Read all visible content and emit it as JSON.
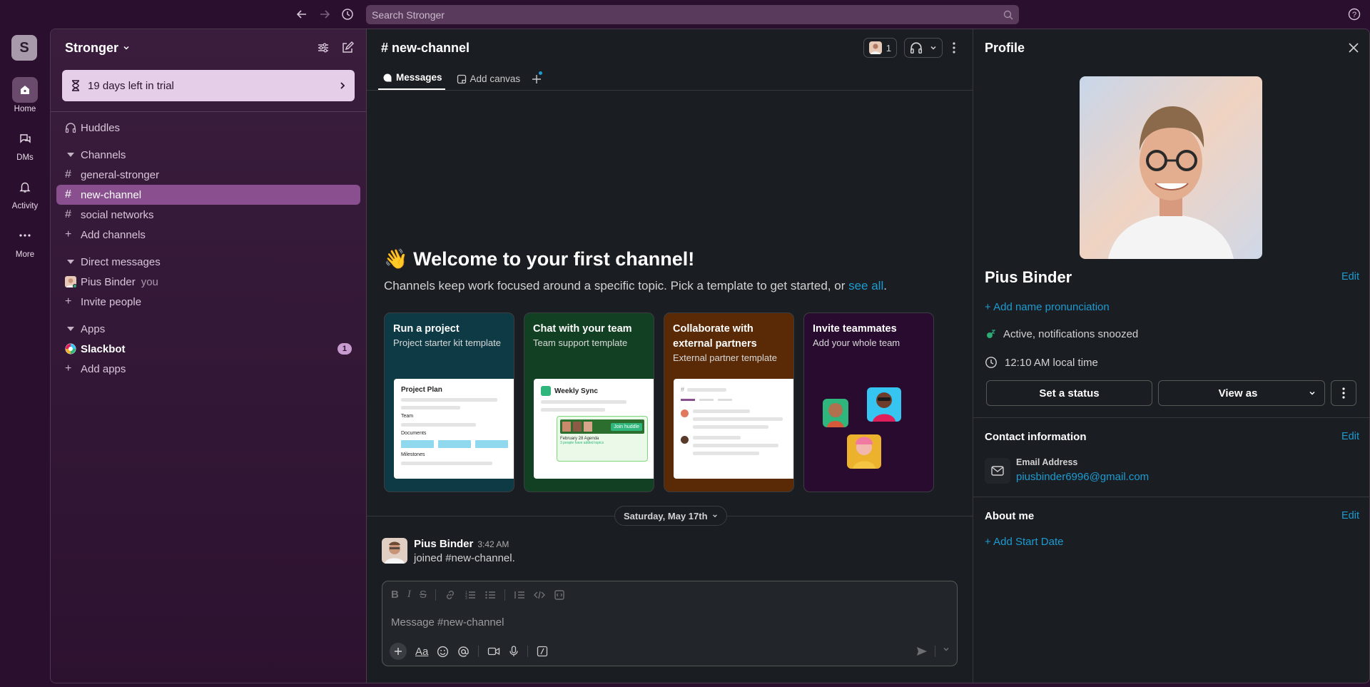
{
  "topbar": {
    "search_placeholder": "Search Stronger"
  },
  "rail": {
    "workspace_initial": "S",
    "items": [
      {
        "label": "Home",
        "icon": "home-icon"
      },
      {
        "label": "DMs",
        "icon": "dms-icon"
      },
      {
        "label": "Activity",
        "icon": "bell-icon"
      },
      {
        "label": "More",
        "icon": "more-icon"
      }
    ]
  },
  "sidebar": {
    "workspace_name": "Stronger",
    "trial_text": "19 days left in trial",
    "huddles": "Huddles",
    "channels_header": "Channels",
    "channels": [
      "general-stronger",
      "new-channel",
      "social networks"
    ],
    "add_channels": "Add channels",
    "dms_header": "Direct messages",
    "dm_user": "Pius Binder",
    "dm_you": "you",
    "invite_people": "Invite people",
    "apps_header": "Apps",
    "slackbot": "Slackbot",
    "slackbot_badge": "1",
    "add_apps": "Add apps"
  },
  "channel": {
    "title": "# new-channel",
    "member_count": "1",
    "tabs": [
      "Messages",
      "Add canvas"
    ],
    "welcome_emoji": "👋",
    "welcome_title": "Welcome to your first channel!",
    "welcome_text": "Channels keep work focused around a specific topic. Pick a template to get started, or",
    "see_all": "see all",
    "period": ".",
    "cards": [
      {
        "title": "Run a project",
        "subtitle": "Project starter kit template",
        "bg": "#0d3a45",
        "preview_title": "Project Plan",
        "preview_labels": [
          "Team",
          "Documents",
          "Milestones"
        ]
      },
      {
        "title": "Chat with your team",
        "subtitle": "Team support template",
        "bg": "#124023",
        "preview_title": "Weekly Sync",
        "preview_button": "Join huddle",
        "preview_caption": "February 28 Agenda",
        "preview_caption2": "3 people have added topics"
      },
      {
        "title": "Collaborate with external partners",
        "subtitle": "External partner template",
        "bg": "#5a2a06"
      },
      {
        "title": "Invite teammates",
        "subtitle": "Add your whole team",
        "bg": "#2a0b30"
      }
    ],
    "date_divider": "Saturday, May 17th",
    "message": {
      "author": "Pius Binder",
      "time": "3:42 AM",
      "text": "joined #new-channel."
    },
    "composer_placeholder": "Message #new-channel",
    "composer_text_format": "Aa"
  },
  "profile": {
    "header": "Profile",
    "name": "Pius Binder",
    "edit": "Edit",
    "add_pronunciation": "+ Add name pronunciation",
    "status": "Active, notifications snoozed",
    "local_time": "12:10 AM local time",
    "set_status": "Set a status",
    "view_as": "View as",
    "contact_header": "Contact information",
    "email_label": "Email Address",
    "email": "piusbinder6996@gmail.com",
    "about_header": "About me",
    "add_start_date": "+ Add Start Date"
  },
  "colors": {
    "accent_link": "#1d9bd1",
    "active_channel": "#8a4f8f",
    "status_green": "#2bac76"
  }
}
